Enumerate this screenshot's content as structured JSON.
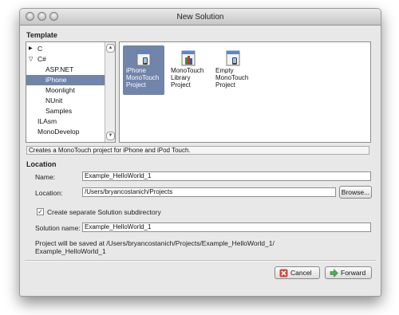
{
  "window": {
    "title": "New Solution"
  },
  "template": {
    "section_label": "Template",
    "tree": [
      {
        "label": "C",
        "arrow": "▶"
      },
      {
        "label": "C#",
        "arrow": "▽"
      },
      {
        "label": "ASP.NET"
      },
      {
        "label": "iPhone",
        "selected": true
      },
      {
        "label": "Moonlight"
      },
      {
        "label": "NUnit"
      },
      {
        "label": "Samples"
      },
      {
        "label": "ILAsm"
      },
      {
        "label": "MonoDevelop"
      }
    ],
    "items": [
      {
        "line1": "iPhone",
        "line2": "MonoTouch",
        "line3": "Project",
        "selected": true,
        "icon": "iphone-project-icon"
      },
      {
        "line1": "MonoTouch",
        "line2": "Library",
        "line3": "Project",
        "icon": "library-project-icon"
      },
      {
        "line1": "Empty",
        "line2": "MonoTouch",
        "line3": "Project",
        "icon": "empty-project-icon"
      }
    ],
    "description": "Creates a MonoTouch project for iPhone and iPod Touch."
  },
  "location": {
    "section_label": "Location",
    "name_label": "Name:",
    "name_value": "Example_HelloWorld_1",
    "location_label": "Location:",
    "location_value": "/Users/bryancostanich/Projects",
    "browse_label": "Browse...",
    "subdir_checkbox_label": "Create separate Solution subdirectory",
    "subdir_checked": true,
    "solution_name_label": "Solution name:",
    "solution_name_value": "Example_HelloWorld_1",
    "save_info_line1": "Project will be saved at /Users/bryancostanich/Projects/Example_HelloWorld_1/",
    "save_info_line2": "Example_HelloWorld_1"
  },
  "footer": {
    "cancel_label": "Cancel",
    "forward_label": "Forward"
  },
  "colors": {
    "selection": "#7184a9",
    "window_bg": "#e8e8e8"
  }
}
